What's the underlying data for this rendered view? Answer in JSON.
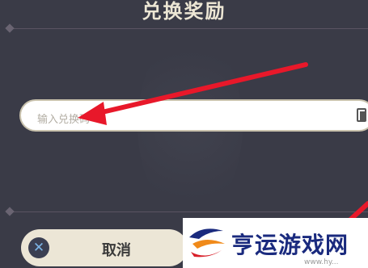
{
  "dialog": {
    "title": "兑换奖励",
    "input": {
      "placeholder": "输入兑换码"
    },
    "cancel_button": {
      "label": "取消",
      "icon": "close-icon"
    }
  },
  "overlay": {
    "arrow_color": "#e8182a",
    "watermark_text": "亨运游戏网",
    "watermark_url": "www.hy..."
  },
  "colors": {
    "background": "#3a3b47",
    "title": "#ece6d4",
    "button_bg": "#ece6d6",
    "watermark_blue": "#1a2a7e"
  }
}
